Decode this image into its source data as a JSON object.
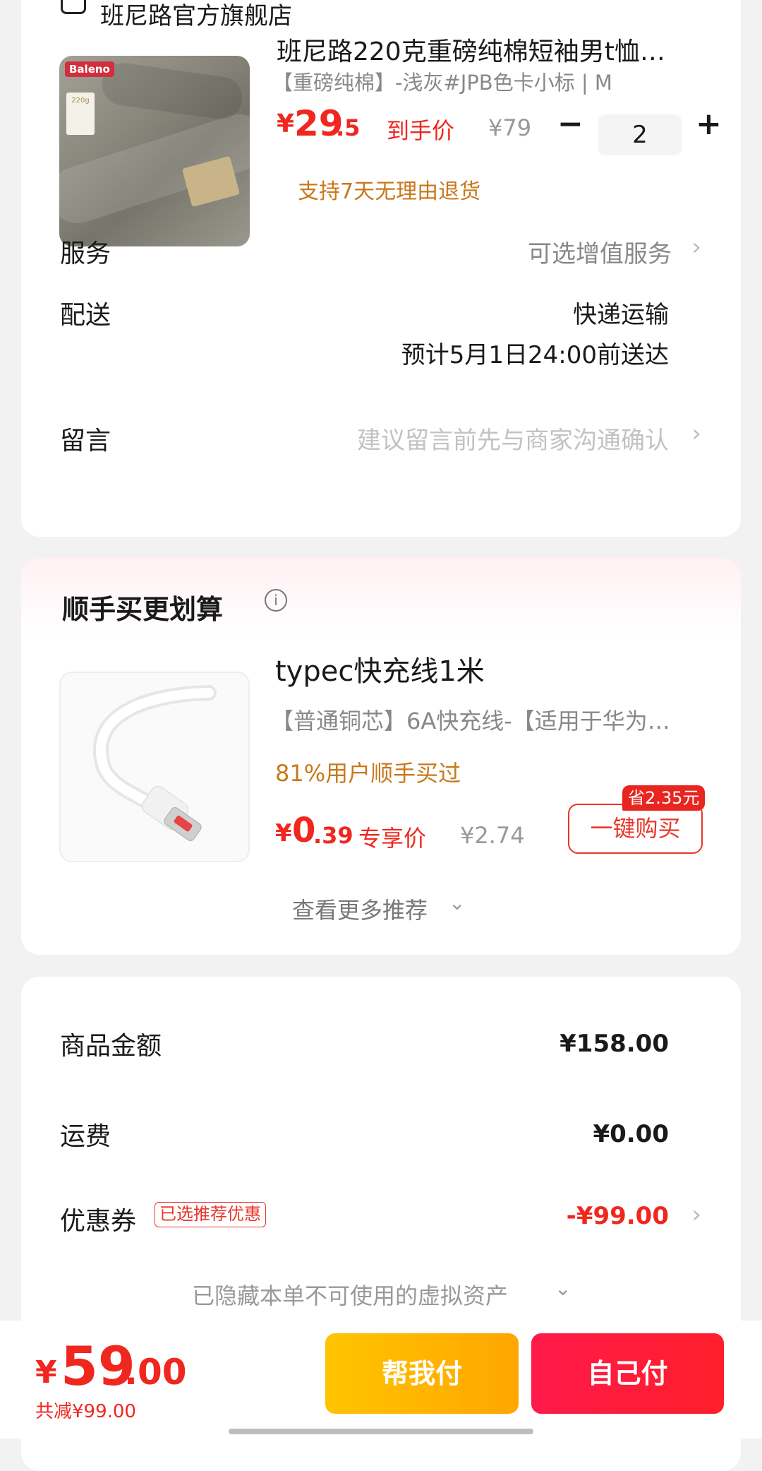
{
  "shop": {
    "name": "班尼路官方旗舰店"
  },
  "product": {
    "title": "班尼路220克重磅纯棉短袖男t恤…",
    "sku": "【重磅纯棉】-浅灰#JPB色卡小标 | M",
    "image_logo": "Baleno",
    "image_tag": "220g",
    "price_symbol": "¥",
    "price_int": "29",
    "price_dec": ".5",
    "price_label": "到手价",
    "orig_price": "¥79",
    "qty": "2",
    "return_policy": "支持7天无理由退货"
  },
  "service": {
    "label": "服务",
    "value": "可选增值服务"
  },
  "delivery": {
    "label": "配送",
    "method": "快递运输",
    "eta": "预计5月1日24:00前送达"
  },
  "message": {
    "label": "留言",
    "placeholder": "建议留言前先与商家沟通确认"
  },
  "upsell": {
    "heading": "顺手买更划算",
    "item": {
      "title": "typec快充线1米",
      "desc": "【普通铜芯】6A快充线-【适用于华为…",
      "social": "81%用户顺手买过",
      "price_symbol": "¥",
      "price_int": "0",
      "price_dec": ".39",
      "price_label": "专享价",
      "orig_price": "¥2.74",
      "save": "省2.35元",
      "buy_label": "一键购买"
    },
    "more": "查看更多推荐"
  },
  "summary": {
    "goods_label": "商品金额",
    "goods_value": "¥158.00",
    "shipping_label": "运费",
    "shipping_value": "¥0.00",
    "coupon_label": "优惠券",
    "coupon_tag": "已选推荐优惠",
    "coupon_value": "-¥99.00",
    "hidden_note": "已隐藏本单不可使用的虚拟资产"
  },
  "footer": {
    "total_symbol": "¥",
    "total_int": "59",
    "total_dec": ".00",
    "discount": "共减¥99.00",
    "help_pay": "帮我付",
    "self_pay": "自己付"
  },
  "colors": {
    "accent_red": "#f0271f",
    "orange_text": "#c8781b",
    "help_pay": "#ffb300",
    "self_pay": "#ff1e3c"
  }
}
